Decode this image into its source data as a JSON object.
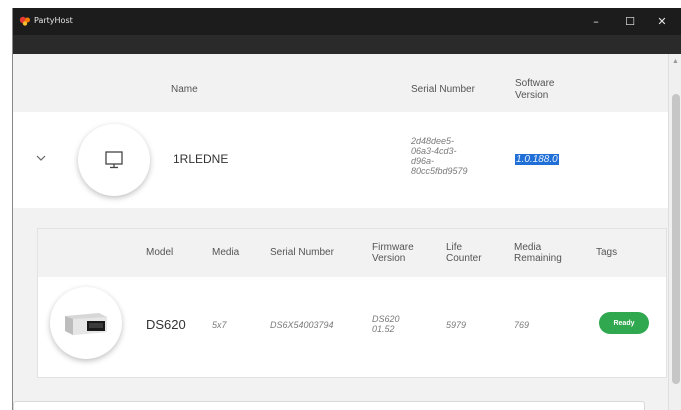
{
  "window": {
    "title": "PartyHost",
    "controls": {
      "minimize": "–",
      "maximize": "☐",
      "close": "✕"
    }
  },
  "host_table": {
    "headers": {
      "name": "Name",
      "serial_number": "Serial Number",
      "software_version_line1": "Software",
      "software_version_line2": "Version"
    },
    "row": {
      "name": "1RLEDNE",
      "serial_lines": [
        "2d48dee5-",
        "06a3-4cd3-",
        "d96a-",
        "80cc5fbd9579"
      ],
      "software_version": "1.0.188.0"
    }
  },
  "printer_table": {
    "headers": {
      "model": "Model",
      "media": "Media",
      "serial_number": "Serial Number",
      "firmware_line1": "Firmware",
      "firmware_line2": "Version",
      "life_line1": "Life",
      "life_line2": "Counter",
      "media_rem_line1": "Media",
      "media_rem_line2": "Remaining",
      "tags": "Tags"
    },
    "row": {
      "model": "DS620",
      "media": "5x7",
      "serial_number": "DS6X54003794",
      "firmware_line1": "DS620",
      "firmware_line2": "01.52",
      "life_counter": "5979",
      "media_remaining": "769",
      "tag": "Ready"
    }
  },
  "colors": {
    "titlebar": "#1c1c1c",
    "selection": "#1f6fd6",
    "ready_tag": "#2fa84f"
  },
  "icons": {
    "app": "party-logo-icon",
    "expand": "chevron-down-icon",
    "host": "monitor-icon",
    "printer": "printer-icon"
  }
}
